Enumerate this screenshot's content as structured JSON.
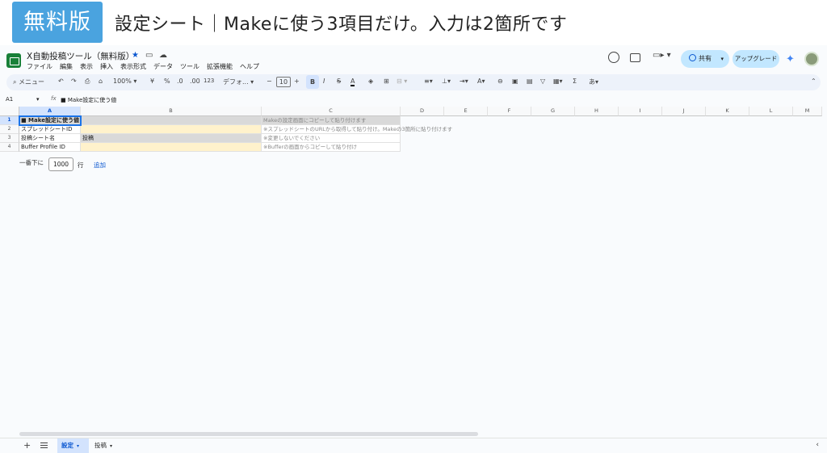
{
  "banner": {
    "badge": "無料版",
    "headline": "設定シート｜Makeに使う3項目だけ。入力は2箇所です"
  },
  "app": {
    "title": "X自動投稿ツール（無料版）",
    "menu": [
      "ファイル",
      "編集",
      "表示",
      "挿入",
      "表示形式",
      "データ",
      "ツール",
      "拡張機能",
      "ヘルプ"
    ],
    "share_label": "共有",
    "upgrade_label": "アップグレード"
  },
  "toolbar": {
    "menu_search": "メニュー",
    "zoom": "100%",
    "currency": "¥",
    "percent": "%",
    "dec_less": ".0",
    "dec_more": ".00",
    "number_format": "123",
    "font": "デフォ...",
    "font_size": "10",
    "bold": "B",
    "italic": "I",
    "strike": "S",
    "text_color": "A",
    "sum": "Σ"
  },
  "formula_bar": {
    "name_box": "A1",
    "fx": "fx",
    "content": "■ Make設定に使う値"
  },
  "grid": {
    "columns": [
      "A",
      "B",
      "C",
      "D",
      "E",
      "F",
      "G",
      "H",
      "I",
      "J",
      "K",
      "L",
      "M"
    ],
    "rows": [
      {
        "num": "1",
        "a": "■ Make設定に使う値",
        "b": "",
        "c": "Makeの設定画面にコピーして貼り付けます"
      },
      {
        "num": "2",
        "a": "スプレッドシートID",
        "b": "",
        "c": "※スプレッドシートのURLから取得して貼り付け。Makeの3箇所に貼り付けます"
      },
      {
        "num": "3",
        "a": "投稿シート名",
        "b": "投稿",
        "c": "※変更しないでください"
      },
      {
        "num": "4",
        "a": "Buffer Profile ID",
        "b": "",
        "c": "※Bufferの画面からコピーして貼り付け"
      }
    ]
  },
  "add_rows": {
    "prefix": "一番下に",
    "count": "1000",
    "suffix": "行",
    "button": "追加"
  },
  "sheet_tabs": {
    "active": "設定",
    "other": "投稿"
  }
}
